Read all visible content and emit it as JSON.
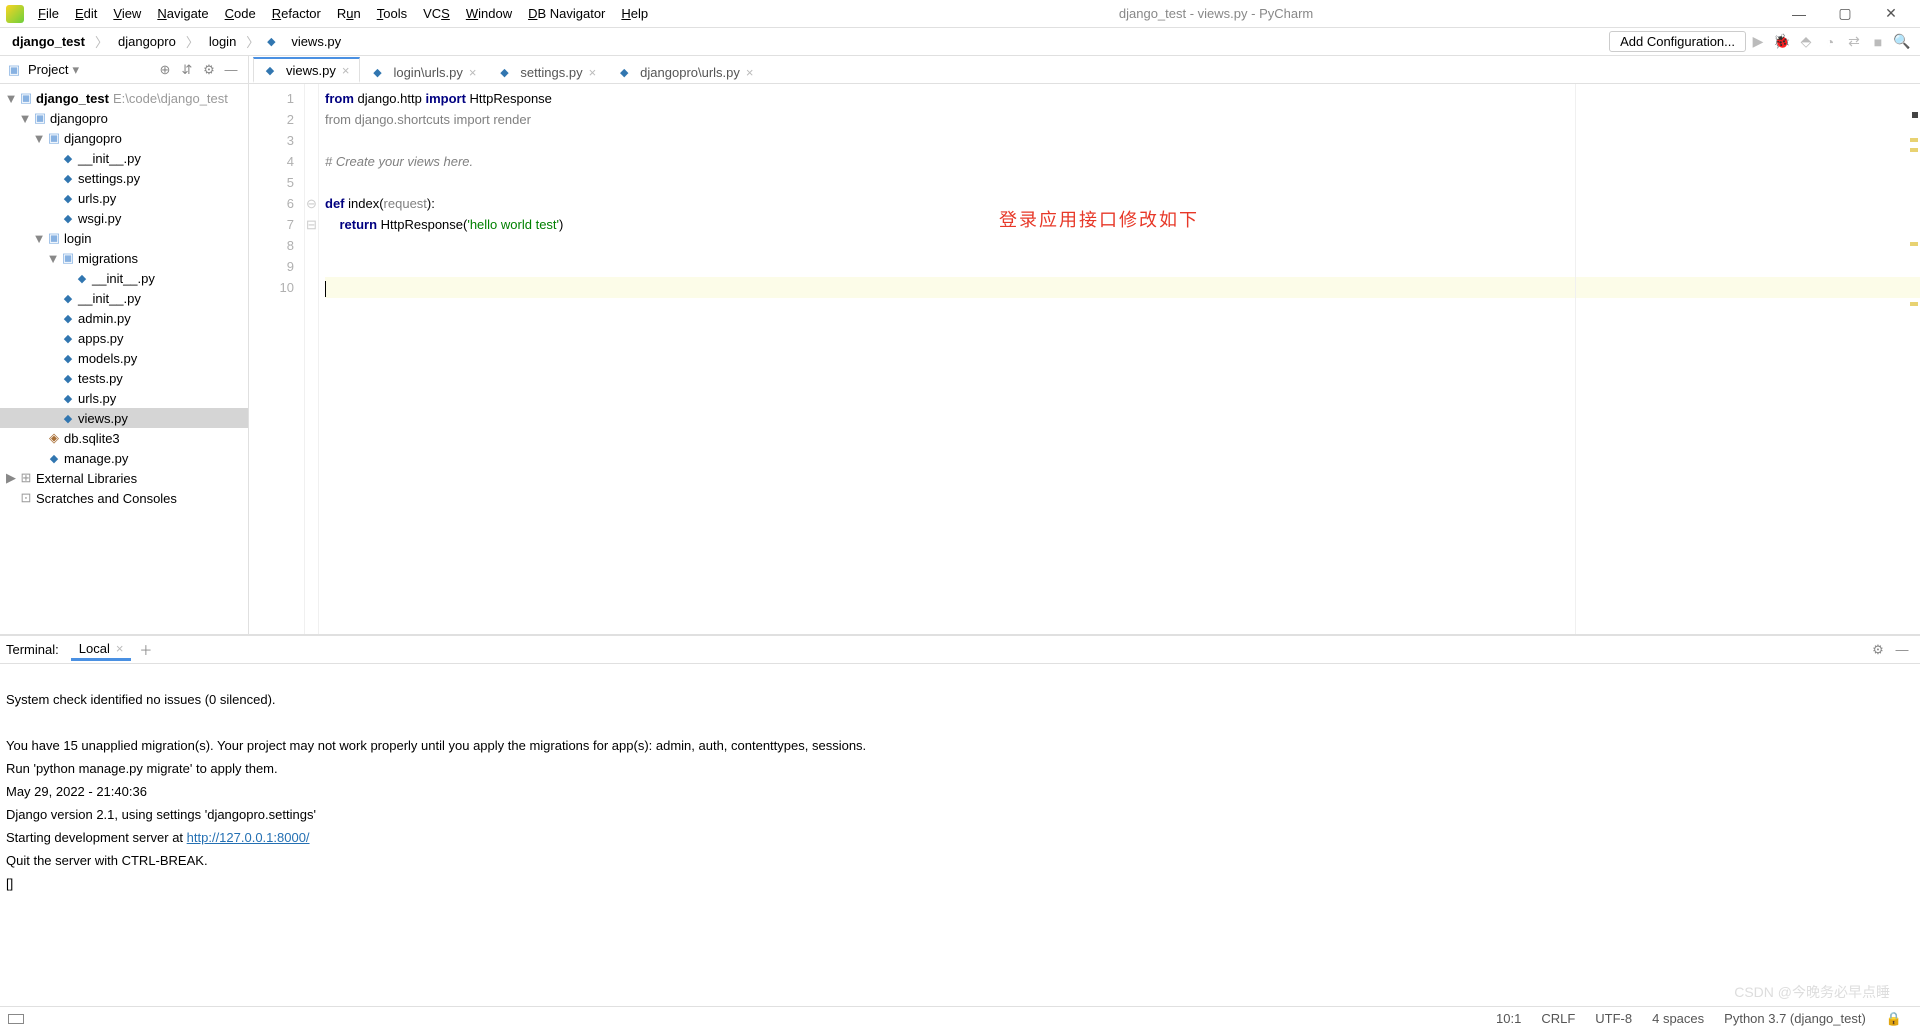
{
  "window": {
    "title": "django_test - views.py - PyCharm"
  },
  "menu": [
    "File",
    "Edit",
    "View",
    "Navigate",
    "Code",
    "Refactor",
    "Run",
    "Tools",
    "VCS",
    "Window",
    "DB Navigator",
    "Help"
  ],
  "breadcrumb": {
    "root": "django_test",
    "p1": "djangopro",
    "p2": "login",
    "file": "views.py"
  },
  "toolbar": {
    "add_config": "Add Configuration..."
  },
  "project": {
    "header": "Project",
    "root_name": "django_test",
    "root_path": "E:\\code\\django_test",
    "ext_lib": "External Libraries",
    "scratches": "Scratches and Consoles",
    "tree": {
      "djangopro": "djangopro",
      "djangopro2": "djangopro",
      "init": "__init__.py",
      "settings": "settings.py",
      "urls": "urls.py",
      "wsgi": "wsgi.py",
      "login": "login",
      "migrations": "migrations",
      "init2": "__init__.py",
      "init3": "__init__.py",
      "admin": "admin.py",
      "apps": "apps.py",
      "models": "models.py",
      "tests": "tests.py",
      "urls2": "urls.py",
      "views": "views.py",
      "dbsqlite": "db.sqlite3",
      "manage": "manage.py"
    }
  },
  "tabs": [
    {
      "label": "views.py",
      "active": true
    },
    {
      "label": "login\\urls.py",
      "active": false
    },
    {
      "label": "settings.py",
      "active": false
    },
    {
      "label": "djangopro\\urls.py",
      "active": false
    }
  ],
  "code": {
    "l1a": "from",
    "l1b": " django.http ",
    "l1c": "import",
    "l1d": " HttpResponse",
    "l2": "from django.shortcuts import render",
    "l4": "# Create your views here.",
    "l6a": "def ",
    "l6b": "index(",
    "l6c": "request",
    "l6d": "):",
    "l7a": "    ",
    "l7b": "return ",
    "l7c": "HttpResponse(",
    "l7d": "'hello world test'",
    "l7e": ")",
    "lines": [
      "1",
      "2",
      "3",
      "4",
      "5",
      "6",
      "7",
      "8",
      "9",
      "10"
    ]
  },
  "annotation": "登录应用接口修改如下",
  "terminal": {
    "label": "Terminal:",
    "tab": "Local",
    "l1": "System check identified no issues (0 silenced).",
    "l2": "",
    "l3": "You have 15 unapplied migration(s). Your project may not work properly until you apply the migrations for app(s): admin, auth, contenttypes, sessions.",
    "l4": "Run 'python manage.py migrate' to apply them.",
    "l5": "May 29, 2022 - 21:40:36",
    "l6": "Django version 2.1, using settings 'djangopro.settings'",
    "l7a": "Starting development server at ",
    "l7b": "http://127.0.0.1:8000/",
    "l8": "Quit the server with CTRL-BREAK.",
    "l9": "[]"
  },
  "status": {
    "pos": "10:1",
    "eol": "CRLF",
    "enc": "UTF-8",
    "indent": "4 spaces",
    "interp": "Python 3.7 (django_test)"
  },
  "watermark": "CSDN @今晚务必早点睡"
}
